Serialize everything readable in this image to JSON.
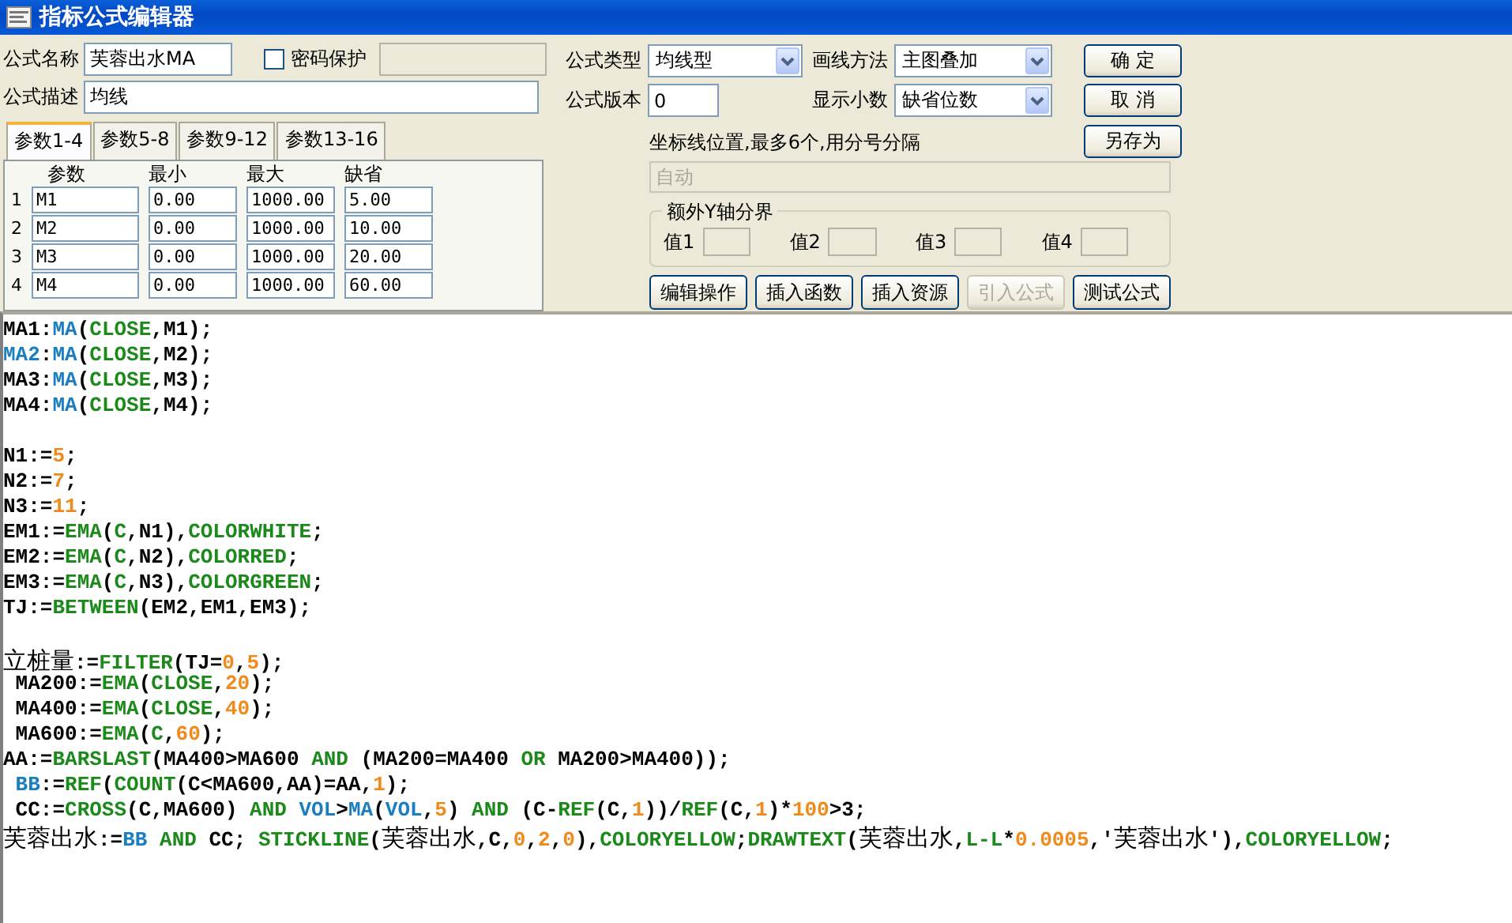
{
  "window": {
    "title": "指标公式编辑器"
  },
  "form": {
    "name": {
      "label": "公式名称",
      "value": "芙蓉出水MA"
    },
    "password": {
      "label": "密码保护",
      "checked": false
    },
    "type": {
      "label": "公式类型",
      "value": "均线型"
    },
    "draw_method": {
      "label": "画线方法",
      "value": "主图叠加"
    },
    "description": {
      "label": "公式描述",
      "value": "均线"
    },
    "version": {
      "label": "公式版本",
      "value": "0"
    },
    "decimals": {
      "label": "显示小数",
      "value": "缺省位数"
    }
  },
  "dialog_buttons": {
    "confirm": "确 定",
    "cancel": "取 消",
    "save_as": "另存为"
  },
  "param_tabs": [
    {
      "label": "参数1-4",
      "selected": true
    },
    {
      "label": "参数5-8",
      "selected": false
    },
    {
      "label": "参数9-12",
      "selected": false
    },
    {
      "label": "参数13-16",
      "selected": false
    }
  ],
  "param_table": {
    "columns": [
      "参数",
      "最小",
      "最大",
      "缺省"
    ],
    "rows": [
      {
        "index": "1",
        "cells": [
          "M1",
          "0.00",
          "1000.00",
          "5.00"
        ]
      },
      {
        "index": "2",
        "cells": [
          "M2",
          "0.00",
          "1000.00",
          "10.00"
        ]
      },
      {
        "index": "3",
        "cells": [
          "M3",
          "0.00",
          "1000.00",
          "20.00"
        ]
      },
      {
        "index": "4",
        "cells": [
          "M4",
          "0.00",
          "1000.00",
          "60.00"
        ]
      }
    ]
  },
  "axis_lines": {
    "label": "坐标线位置,最多6个,用分号分隔",
    "value": "自动",
    "disabled": true
  },
  "y_axis_bounds": {
    "title": "额外Y轴分界",
    "fields": [
      {
        "label": "值1"
      },
      {
        "label": "值2"
      },
      {
        "label": "值3"
      },
      {
        "label": "值4"
      }
    ]
  },
  "action_buttons": [
    {
      "label": "编辑操作",
      "disabled": false
    },
    {
      "label": "插入函数",
      "disabled": false
    },
    {
      "label": "插入资源",
      "disabled": false
    },
    {
      "label": "引入公式",
      "disabled": true
    },
    {
      "label": "测试公式",
      "disabled": false
    }
  ],
  "code": {
    "lines": [
      {
        "kind": "code",
        "tokens": [
          {
            "kind": "plain",
            "text": "MA1:"
          },
          {
            "kind": "kw",
            "text": "MA"
          },
          {
            "kind": "plain",
            "text": "("
          },
          {
            "kind": "fn",
            "text": "CLOSE"
          },
          {
            "kind": "plain",
            "text": ",M1);"
          }
        ]
      },
      {
        "kind": "code",
        "tokens": [
          {
            "kind": "kw",
            "text": "MA2"
          },
          {
            "kind": "plain",
            "text": ":"
          },
          {
            "kind": "kw",
            "text": "MA"
          },
          {
            "kind": "plain",
            "text": "("
          },
          {
            "kind": "fn",
            "text": "CLOSE"
          },
          {
            "kind": "plain",
            "text": ",M2);"
          }
        ]
      },
      {
        "kind": "code",
        "tokens": [
          {
            "kind": "plain",
            "text": "MA3:"
          },
          {
            "kind": "kw",
            "text": "MA"
          },
          {
            "kind": "plain",
            "text": "("
          },
          {
            "kind": "fn",
            "text": "CLOSE"
          },
          {
            "kind": "plain",
            "text": ",M3);"
          }
        ]
      },
      {
        "kind": "code",
        "tokens": [
          {
            "kind": "plain",
            "text": "MA4:"
          },
          {
            "kind": "kw",
            "text": "MA"
          },
          {
            "kind": "plain",
            "text": "("
          },
          {
            "kind": "fn",
            "text": "CLOSE"
          },
          {
            "kind": "plain",
            "text": ",M4);"
          }
        ]
      },
      {
        "kind": "blank"
      },
      {
        "kind": "code",
        "tokens": [
          {
            "kind": "plain",
            "text": "N1:="
          },
          {
            "kind": "num",
            "text": "5"
          },
          {
            "kind": "plain",
            "text": ";"
          }
        ]
      },
      {
        "kind": "code",
        "tokens": [
          {
            "kind": "plain",
            "text": "N2:="
          },
          {
            "kind": "num",
            "text": "7"
          },
          {
            "kind": "plain",
            "text": ";"
          }
        ]
      },
      {
        "kind": "code",
        "tokens": [
          {
            "kind": "plain",
            "text": "N3:="
          },
          {
            "kind": "num",
            "text": "11"
          },
          {
            "kind": "plain",
            "text": ";"
          }
        ]
      },
      {
        "kind": "code",
        "tokens": [
          {
            "kind": "plain",
            "text": "EM1:="
          },
          {
            "kind": "fn",
            "text": "EMA"
          },
          {
            "kind": "plain",
            "text": "("
          },
          {
            "kind": "fn",
            "text": "C"
          },
          {
            "kind": "plain",
            "text": ",N1),"
          },
          {
            "kind": "fn",
            "text": "COLORWHITE"
          },
          {
            "kind": "plain",
            "text": ";"
          }
        ]
      },
      {
        "kind": "code",
        "tokens": [
          {
            "kind": "plain",
            "text": "EM2:="
          },
          {
            "kind": "fn",
            "text": "EMA"
          },
          {
            "kind": "plain",
            "text": "("
          },
          {
            "kind": "fn",
            "text": "C"
          },
          {
            "kind": "plain",
            "text": ",N2),"
          },
          {
            "kind": "fn",
            "text": "COLORRED"
          },
          {
            "kind": "plain",
            "text": ";"
          }
        ]
      },
      {
        "kind": "code",
        "tokens": [
          {
            "kind": "plain",
            "text": "EM3:="
          },
          {
            "kind": "fn",
            "text": "EMA"
          },
          {
            "kind": "plain",
            "text": "("
          },
          {
            "kind": "fn",
            "text": "C"
          },
          {
            "kind": "plain",
            "text": ",N3),"
          },
          {
            "kind": "fn",
            "text": "COLORGREEN"
          },
          {
            "kind": "plain",
            "text": ";"
          }
        ]
      },
      {
        "kind": "code",
        "tokens": [
          {
            "kind": "plain",
            "text": "TJ:="
          },
          {
            "kind": "fn",
            "text": "BETWEEN"
          },
          {
            "kind": "plain",
            "text": "(EM2,EM1,EM3);"
          }
        ]
      },
      {
        "kind": "blank"
      },
      {
        "kind": "code",
        "tokens": [
          {
            "kind": "cjk",
            "text": "立桩量"
          },
          {
            "kind": "plain",
            "text": ":="
          },
          {
            "kind": "fn",
            "text": "FILTER"
          },
          {
            "kind": "plain",
            "text": "(TJ="
          },
          {
            "kind": "num",
            "text": "0"
          },
          {
            "kind": "plain",
            "text": ","
          },
          {
            "kind": "num",
            "text": "5"
          },
          {
            "kind": "plain",
            "text": ");"
          }
        ]
      },
      {
        "kind": "code",
        "tokens": [
          {
            "kind": "plain",
            "text": " MA200:="
          },
          {
            "kind": "fn",
            "text": "EMA"
          },
          {
            "kind": "plain",
            "text": "("
          },
          {
            "kind": "fn",
            "text": "CLOSE"
          },
          {
            "kind": "plain",
            "text": ","
          },
          {
            "kind": "num",
            "text": "20"
          },
          {
            "kind": "plain",
            "text": ");"
          }
        ]
      },
      {
        "kind": "code",
        "tokens": [
          {
            "kind": "plain",
            "text": " MA400:="
          },
          {
            "kind": "fn",
            "text": "EMA"
          },
          {
            "kind": "plain",
            "text": "("
          },
          {
            "kind": "fn",
            "text": "CLOSE"
          },
          {
            "kind": "plain",
            "text": ","
          },
          {
            "kind": "num",
            "text": "40"
          },
          {
            "kind": "plain",
            "text": ");"
          }
        ]
      },
      {
        "kind": "code",
        "tokens": [
          {
            "kind": "plain",
            "text": " MA600:="
          },
          {
            "kind": "fn",
            "text": "EMA"
          },
          {
            "kind": "plain",
            "text": "("
          },
          {
            "kind": "fn",
            "text": "C"
          },
          {
            "kind": "plain",
            "text": ","
          },
          {
            "kind": "num",
            "text": "60"
          },
          {
            "kind": "plain",
            "text": ");"
          }
        ]
      },
      {
        "kind": "code",
        "tokens": [
          {
            "kind": "plain",
            "text": "AA:="
          },
          {
            "kind": "fn",
            "text": "BARSLAST"
          },
          {
            "kind": "plain",
            "text": "(MA400>MA600 "
          },
          {
            "kind": "fn",
            "text": "AND"
          },
          {
            "kind": "plain",
            "text": " (MA200=MA400 "
          },
          {
            "kind": "fn",
            "text": "OR"
          },
          {
            "kind": "plain",
            "text": " MA200>MA400));"
          }
        ]
      },
      {
        "kind": "code",
        "tokens": [
          {
            "kind": "kw",
            "text": " BB"
          },
          {
            "kind": "plain",
            "text": ":="
          },
          {
            "kind": "fn",
            "text": "REF"
          },
          {
            "kind": "plain",
            "text": "("
          },
          {
            "kind": "fn",
            "text": "COUNT"
          },
          {
            "kind": "plain",
            "text": "(C<MA600,AA)=AA,"
          },
          {
            "kind": "num",
            "text": "1"
          },
          {
            "kind": "plain",
            "text": ");"
          }
        ]
      },
      {
        "kind": "code",
        "tokens": [
          {
            "kind": "plain",
            "text": " CC:="
          },
          {
            "kind": "fn",
            "text": "CROSS"
          },
          {
            "kind": "plain",
            "text": "(C,MA600) "
          },
          {
            "kind": "fn",
            "text": "AND"
          },
          {
            "kind": "kw",
            "text": " VOL"
          },
          {
            "kind": "plain",
            "text": ">"
          },
          {
            "kind": "kw",
            "text": "MA"
          },
          {
            "kind": "plain",
            "text": "("
          },
          {
            "kind": "kw",
            "text": "VOL"
          },
          {
            "kind": "plain",
            "text": ","
          },
          {
            "kind": "num",
            "text": "5"
          },
          {
            "kind": "plain",
            "text": ") "
          },
          {
            "kind": "fn",
            "text": "AND"
          },
          {
            "kind": "plain",
            "text": " (C-"
          },
          {
            "kind": "fn",
            "text": "REF"
          },
          {
            "kind": "plain",
            "text": "(C,"
          },
          {
            "kind": "num",
            "text": "1"
          },
          {
            "kind": "plain",
            "text": "))/"
          },
          {
            "kind": "fn",
            "text": "REF"
          },
          {
            "kind": "plain",
            "text": "(C,"
          },
          {
            "kind": "num",
            "text": "1"
          },
          {
            "kind": "plain",
            "text": ")*"
          },
          {
            "kind": "num",
            "text": "100"
          },
          {
            "kind": "plain",
            "text": ">3;"
          }
        ]
      },
      {
        "kind": "code",
        "tokens": [
          {
            "kind": "cjk",
            "text": "芙蓉出水"
          },
          {
            "kind": "plain",
            "text": ":="
          },
          {
            "kind": "kw",
            "text": "BB"
          },
          {
            "kind": "fn",
            "text": " AND"
          },
          {
            "kind": "plain",
            "text": " CC; "
          },
          {
            "kind": "fn",
            "text": "STICKLINE"
          },
          {
            "kind": "plain",
            "text": "("
          },
          {
            "kind": "cjk",
            "text": "芙蓉出水"
          },
          {
            "kind": "plain",
            "text": ",C,"
          },
          {
            "kind": "num",
            "text": "0"
          },
          {
            "kind": "plain",
            "text": ","
          },
          {
            "kind": "num",
            "text": "2"
          },
          {
            "kind": "plain",
            "text": ","
          },
          {
            "kind": "num",
            "text": "0"
          },
          {
            "kind": "plain",
            "text": "),"
          },
          {
            "kind": "fn",
            "text": "COLORYELLOW"
          },
          {
            "kind": "plain",
            "text": ";"
          },
          {
            "kind": "fn",
            "text": "DRAWTEXT"
          },
          {
            "kind": "plain",
            "text": "("
          },
          {
            "kind": "cjk",
            "text": "芙蓉出水"
          },
          {
            "kind": "plain",
            "text": ","
          },
          {
            "kind": "fn",
            "text": "L-L"
          },
          {
            "kind": "plain",
            "text": "*"
          },
          {
            "kind": "num",
            "text": "0.0005"
          },
          {
            "kind": "plain",
            "text": ",'"
          },
          {
            "kind": "cjk",
            "text": "芙蓉出水"
          },
          {
            "kind": "plain",
            "text": "'),"
          },
          {
            "kind": "fn",
            "text": "COLORYELLOW"
          },
          {
            "kind": "plain",
            "text": ";"
          }
        ]
      }
    ]
  }
}
